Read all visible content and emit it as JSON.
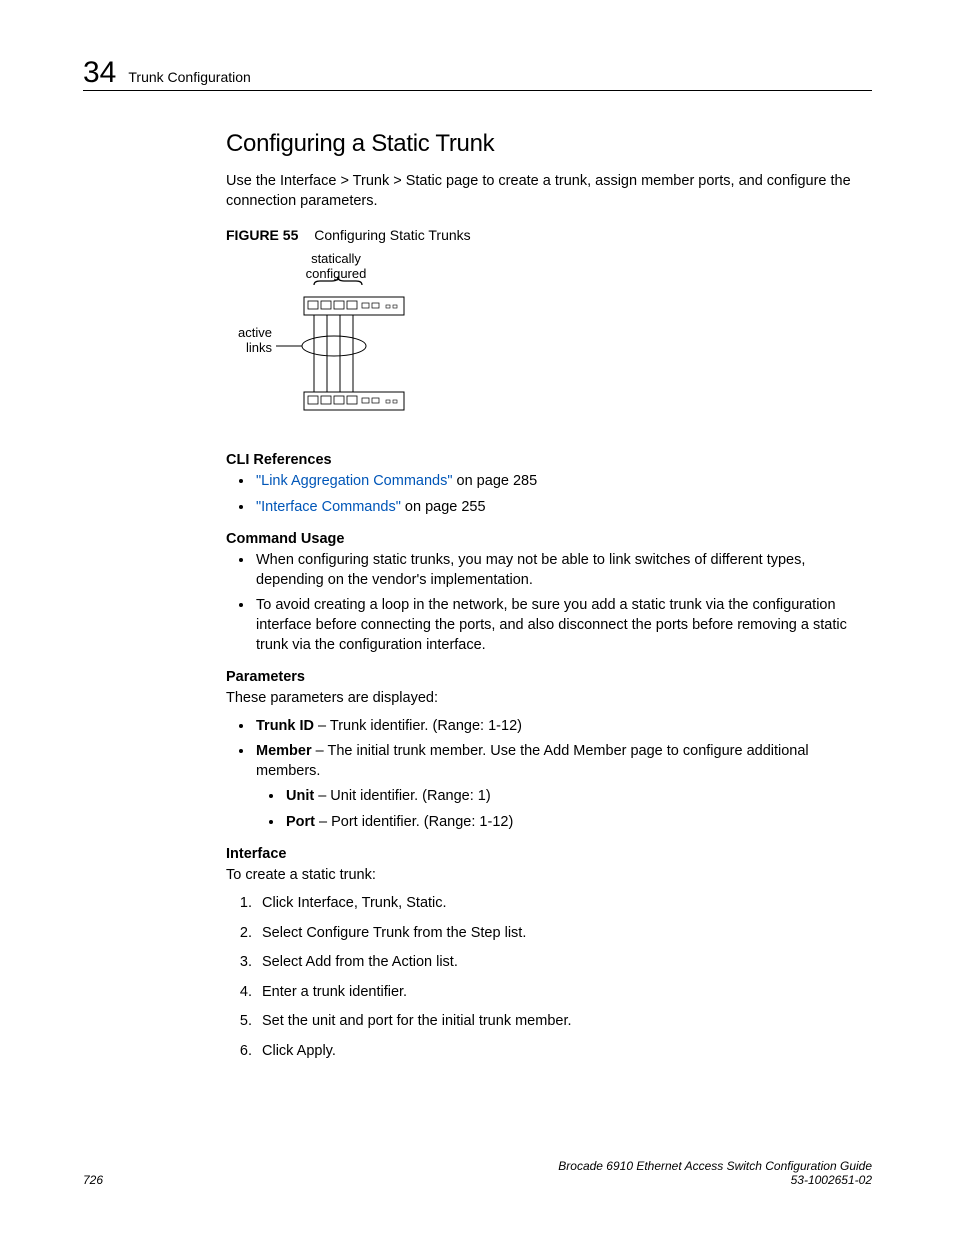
{
  "header": {
    "chapter_number": "34",
    "chapter_title": "Trunk Configuration"
  },
  "section_title": "Configuring a Static Trunk",
  "intro": "Use the Interface > Trunk > Static page to create a trunk, assign member ports, and configure the connection parameters.",
  "figure": {
    "label": "FIGURE 55",
    "caption": "Configuring Static Trunks",
    "label_top": "statically\nconfigured",
    "label_side": "active\nlinks"
  },
  "cli_refs": {
    "heading": "CLI References",
    "items": [
      {
        "link": "\"Link Aggregation Commands\"",
        "suffix": " on page 285"
      },
      {
        "link": "\"Interface Commands\"",
        "suffix": " on page 255"
      }
    ]
  },
  "usage": {
    "heading": "Command Usage",
    "items": [
      "When configuring static trunks, you may not be able to link switches of different types, depending on the vendor's implementation.",
      "To avoid creating a loop in the network, be sure you add a static trunk via the configuration interface before connecting the ports, and also disconnect the ports before removing a static trunk via the configuration interface."
    ]
  },
  "params": {
    "heading": "Parameters",
    "intro": "These parameters are displayed:",
    "items": [
      {
        "term": "Trunk ID",
        "desc": " – Trunk identifier. (Range: 1-12)"
      },
      {
        "term": "Member",
        "desc": " – The initial trunk member. Use the Add Member page to configure additional members.",
        "sub": [
          {
            "term": "Unit",
            "desc": " – Unit identifier. (Range: 1)"
          },
          {
            "term": "Port",
            "desc": " – Port identifier. (Range: 1-12)"
          }
        ]
      }
    ]
  },
  "interface": {
    "heading": "Interface",
    "intro": "To create a static trunk:",
    "steps": [
      "Click Interface, Trunk, Static.",
      "Select Configure Trunk from the Step list.",
      "Select Add from the Action list.",
      "Enter a trunk identifier.",
      "Set the unit and port for the initial trunk member.",
      "Click Apply."
    ]
  },
  "footer": {
    "page_number": "726",
    "doc_title": "Brocade 6910 Ethernet Access Switch Configuration Guide",
    "doc_number": "53-1002651-02"
  }
}
